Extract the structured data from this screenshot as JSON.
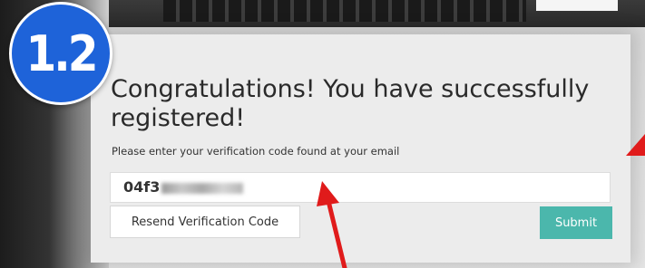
{
  "badge": {
    "label": "1.2"
  },
  "panel": {
    "title": "Congratulations! You have successfully registered!",
    "instruction": "Please enter your verification code found at your email"
  },
  "verification": {
    "code_value": "04f3"
  },
  "buttons": {
    "resend_label": "Resend Verification Code",
    "submit_label": "Submit"
  },
  "colors": {
    "badge": "#1e63d9",
    "submit": "#4bb7ac",
    "arrow": "#e01b1b"
  }
}
